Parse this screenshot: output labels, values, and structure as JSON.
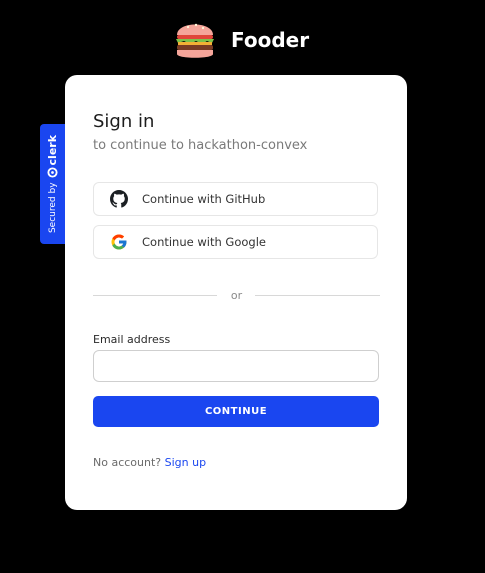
{
  "header": {
    "app_name": "Fooder",
    "logo_icon": "burger-icon"
  },
  "clerk_badge": {
    "secured_by": "Secured by",
    "brand": "clerk",
    "color": "#1a46f0"
  },
  "signin": {
    "title": "Sign in",
    "subtitle": "to continue to hackathon-convex",
    "github_label": "Continue with GitHub",
    "google_label": "Continue with Google",
    "divider_text": "or",
    "email_label": "Email address",
    "email_value": "",
    "continue_label": "CONTINUE",
    "no_account_text": "No account?",
    "signup_link": "Sign up"
  },
  "colors": {
    "accent": "#1a46f0",
    "background": "#000000",
    "card": "#ffffff"
  }
}
